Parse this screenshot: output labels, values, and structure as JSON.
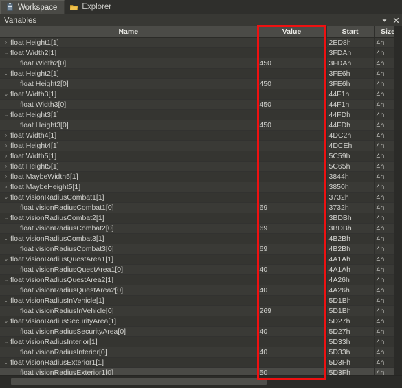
{
  "tabs": [
    {
      "label": "Workspace",
      "icon": "clipboard-icon",
      "active": true
    },
    {
      "label": "Explorer",
      "icon": "folder-icon",
      "active": false
    }
  ],
  "panel": {
    "title": "Variables",
    "dropdown_icon": "chevron-down-icon",
    "close_icon": "close-icon"
  },
  "grid": {
    "columns": [
      {
        "key": "name",
        "label": "Name"
      },
      {
        "key": "value",
        "label": "Value"
      },
      {
        "key": "start",
        "label": "Start"
      },
      {
        "key": "size",
        "label": "Size"
      }
    ],
    "rows": [
      {
        "expander": "collapsed",
        "child": false,
        "name": "float Height1[1]",
        "value": "",
        "start": "2ED8h",
        "size": "4h",
        "selected": false
      },
      {
        "expander": "expanded",
        "child": false,
        "name": "float Width2[1]",
        "value": "",
        "start": "3FDAh",
        "size": "4h",
        "selected": false
      },
      {
        "expander": "none",
        "child": true,
        "name": "float Width2[0]",
        "value": "450",
        "start": "3FDAh",
        "size": "4h",
        "selected": false
      },
      {
        "expander": "expanded",
        "child": false,
        "name": "float Height2[1]",
        "value": "",
        "start": "3FE6h",
        "size": "4h",
        "selected": false
      },
      {
        "expander": "none",
        "child": true,
        "name": "float Height2[0]",
        "value": "450",
        "start": "3FE6h",
        "size": "4h",
        "selected": false
      },
      {
        "expander": "expanded",
        "child": false,
        "name": "float Width3[1]",
        "value": "",
        "start": "44F1h",
        "size": "4h",
        "selected": false
      },
      {
        "expander": "none",
        "child": true,
        "name": "float Width3[0]",
        "value": "450",
        "start": "44F1h",
        "size": "4h",
        "selected": false
      },
      {
        "expander": "expanded",
        "child": false,
        "name": "float Height3[1]",
        "value": "",
        "start": "44FDh",
        "size": "4h",
        "selected": false
      },
      {
        "expander": "none",
        "child": true,
        "name": "float Height3[0]",
        "value": "450",
        "start": "44FDh",
        "size": "4h",
        "selected": false
      },
      {
        "expander": "collapsed",
        "child": false,
        "name": "float Width4[1]",
        "value": "",
        "start": "4DC2h",
        "size": "4h",
        "selected": false
      },
      {
        "expander": "collapsed",
        "child": false,
        "name": "float Height4[1]",
        "value": "",
        "start": "4DCEh",
        "size": "4h",
        "selected": false
      },
      {
        "expander": "collapsed",
        "child": false,
        "name": "float Width5[1]",
        "value": "",
        "start": "5C59h",
        "size": "4h",
        "selected": false
      },
      {
        "expander": "collapsed",
        "child": false,
        "name": "float Height5[1]",
        "value": "",
        "start": "5C65h",
        "size": "4h",
        "selected": false
      },
      {
        "expander": "collapsed",
        "child": false,
        "name": "float MaybeWidth5[1]",
        "value": "",
        "start": "3844h",
        "size": "4h",
        "selected": false
      },
      {
        "expander": "collapsed",
        "child": false,
        "name": "float MaybeHeight5[1]",
        "value": "",
        "start": "3850h",
        "size": "4h",
        "selected": false
      },
      {
        "expander": "expanded",
        "child": false,
        "name": "float visionRadiusCombat1[1]",
        "value": "",
        "start": "3732h",
        "size": "4h",
        "selected": false
      },
      {
        "expander": "none",
        "child": true,
        "name": "float visionRadiusCombat1[0]",
        "value": "69",
        "start": "3732h",
        "size": "4h",
        "selected": false
      },
      {
        "expander": "expanded",
        "child": false,
        "name": "float visionRadiusCombat2[1]",
        "value": "",
        "start": "3BDBh",
        "size": "4h",
        "selected": false
      },
      {
        "expander": "none",
        "child": true,
        "name": "float visionRadiusCombat2[0]",
        "value": "69",
        "start": "3BDBh",
        "size": "4h",
        "selected": false
      },
      {
        "expander": "expanded",
        "child": false,
        "name": "float visionRadiusCombat3[1]",
        "value": "",
        "start": "4B2Bh",
        "size": "4h",
        "selected": false
      },
      {
        "expander": "none",
        "child": true,
        "name": "float visionRadiusCombat3[0]",
        "value": "69",
        "start": "4B2Bh",
        "size": "4h",
        "selected": false
      },
      {
        "expander": "expanded",
        "child": false,
        "name": "float visionRadiusQuestArea1[1]",
        "value": "",
        "start": "4A1Ah",
        "size": "4h",
        "selected": false
      },
      {
        "expander": "none",
        "child": true,
        "name": "float visionRadiusQuestArea1[0]",
        "value": "40",
        "start": "4A1Ah",
        "size": "4h",
        "selected": false
      },
      {
        "expander": "expanded",
        "child": false,
        "name": "float visionRadiusQuestArea2[1]",
        "value": "",
        "start": "4A26h",
        "size": "4h",
        "selected": false
      },
      {
        "expander": "none",
        "child": true,
        "name": "float visionRadiusQuestArea2[0]",
        "value": "40",
        "start": "4A26h",
        "size": "4h",
        "selected": false
      },
      {
        "expander": "expanded",
        "child": false,
        "name": "float visionRadiusInVehicle[1]",
        "value": "",
        "start": "5D1Bh",
        "size": "4h",
        "selected": false
      },
      {
        "expander": "none",
        "child": true,
        "name": "float visionRadiusInVehicle[0]",
        "value": "269",
        "start": "5D1Bh",
        "size": "4h",
        "selected": false
      },
      {
        "expander": "expanded",
        "child": false,
        "name": "float visionRadiusSecurityArea[1]",
        "value": "",
        "start": "5D27h",
        "size": "4h",
        "selected": false
      },
      {
        "expander": "none",
        "child": true,
        "name": "float visionRadiusSecurityArea[0]",
        "value": "40",
        "start": "5D27h",
        "size": "4h",
        "selected": false
      },
      {
        "expander": "expanded",
        "child": false,
        "name": "float visionRadiusInterior[1]",
        "value": "",
        "start": "5D33h",
        "size": "4h",
        "selected": false
      },
      {
        "expander": "none",
        "child": true,
        "name": "float visionRadiusInterior[0]",
        "value": "40",
        "start": "5D33h",
        "size": "4h",
        "selected": false
      },
      {
        "expander": "expanded",
        "child": false,
        "name": "float visionRadiusExterior1[1]",
        "value": "",
        "start": "5D3Fh",
        "size": "4h",
        "selected": false
      },
      {
        "expander": "none",
        "child": true,
        "name": "float visionRadiusExterior1[0]",
        "value": "50",
        "start": "5D3Fh",
        "size": "4h",
        "selected": true
      }
    ]
  },
  "annotation": {
    "shape": "rectangle",
    "color": "#ee1111",
    "targets_column": "Value"
  }
}
